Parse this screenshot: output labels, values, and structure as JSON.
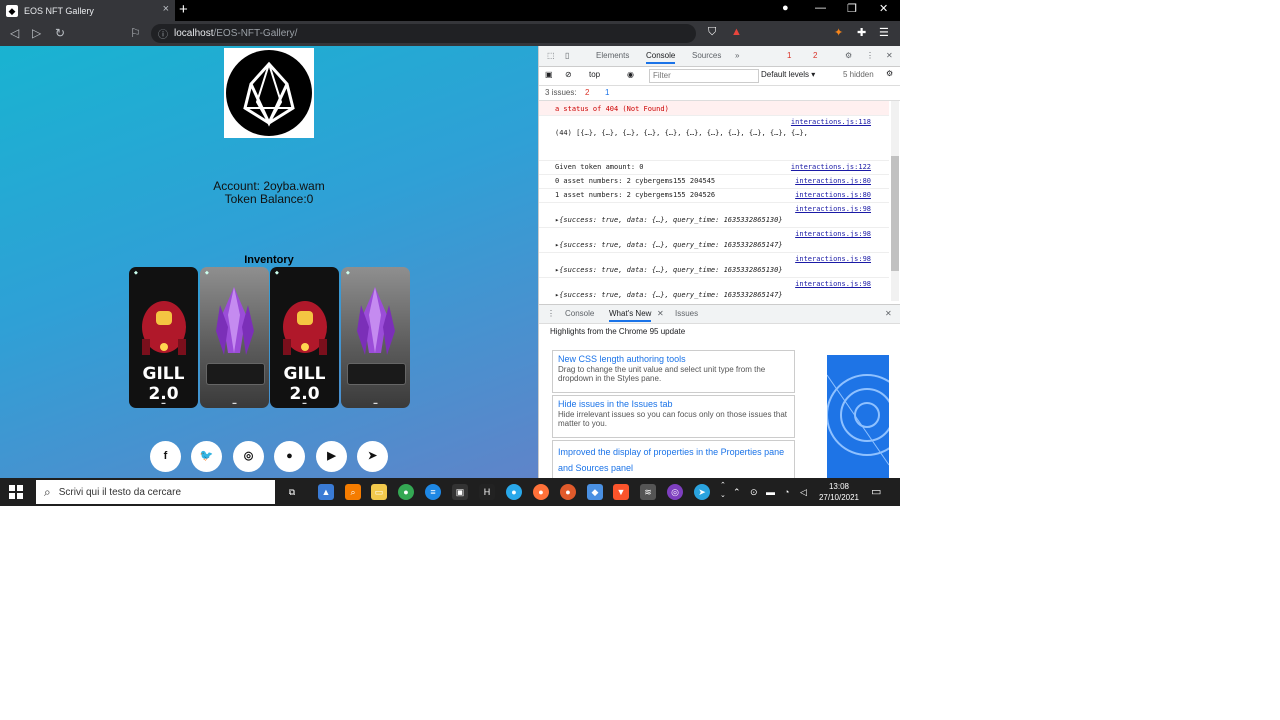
{
  "browser": {
    "tab_title": "EOS NFT Gallery",
    "tab_close": "×",
    "new_tab": "+",
    "url_host": "localhost",
    "url_path": "/EOS-NFT-Gallery/"
  },
  "page": {
    "account_line": "Account: 2oyba.wam",
    "balance_line": "Token Balance:0",
    "inventory_title": "Inventory",
    "cards": [
      {
        "kind": "ship",
        "title": "GILL 2.0"
      },
      {
        "kind": "crystal",
        "title": ""
      },
      {
        "kind": "ship",
        "title": "GILL 2.0"
      },
      {
        "kind": "crystal",
        "title": ""
      }
    ],
    "social_icons": [
      "facebook-icon",
      "twitter-icon",
      "instagram-icon",
      "github-icon",
      "youtube-icon",
      "telegram-icon"
    ]
  },
  "devtools": {
    "tabs": [
      "Elements",
      "Console",
      "Sources",
      "»"
    ],
    "error_count": "1",
    "warning_count": "2",
    "context": "top",
    "filter_placeholder": "Filter",
    "levels": "Default levels ▾",
    "hidden": "5 hidden",
    "issues": "3 issues:",
    "issues_err": "2",
    "issues_info": "1",
    "console_lines": [
      {
        "type": "error",
        "msg": "a status of 404 (Not Found)",
        "src": ""
      },
      {
        "type": "log",
        "msg": "(44) [{…}, {…}, {…}, {…}, {…}, {…}, {…}, {…}, {…}, {…}, {…},",
        "src": "interactions.js:118"
      },
      {
        "type": "log",
        "msg": "Given token amount: 0",
        "src": "interactions.js:122"
      },
      {
        "type": "log",
        "msg": "0 asset numbers: 2 cybergems155 204545",
        "src": "interactions.js:80"
      },
      {
        "type": "log",
        "msg": "1 asset numbers: 2 cybergems155 204526",
        "src": "interactions.js:80"
      },
      {
        "type": "log",
        "msg": "▸{success: true, data: {…}, query_time: 1635332865130}",
        "src": "interactions.js:98"
      },
      {
        "type": "log",
        "msg": "▸{success: true, data: {…}, query_time: 1635332865147}",
        "src": "interactions.js:98"
      },
      {
        "type": "log",
        "msg": "▸{success: true, data: {…}, query_time: 1635332865130}",
        "src": "interactions.js:98"
      },
      {
        "type": "log",
        "msg": "▸{success: true, data: {…}, query_time: 1635332865147}",
        "src": "interactions.js:98"
      }
    ],
    "drawer_tabs": [
      "Console",
      "What's New",
      "Issues"
    ],
    "whats_new_title": "Highlights from the Chrome 95 update",
    "whats_new_items": [
      {
        "heading": "New CSS length authoring tools",
        "desc": "Drag to change the unit value and select unit type from the dropdown in the Styles pane."
      },
      {
        "heading": "Hide issues in the Issues tab",
        "desc": "Hide irrelevant issues so you can focus only on those issues that matter to you."
      },
      {
        "heading": "Improved the display of properties in the Properties pane and Sources panel",
        "desc": ""
      }
    ]
  },
  "taskbar": {
    "search_placeholder": "Scrivi qui il testo da cercare",
    "time": "13:08",
    "date": "27/10/2021"
  }
}
